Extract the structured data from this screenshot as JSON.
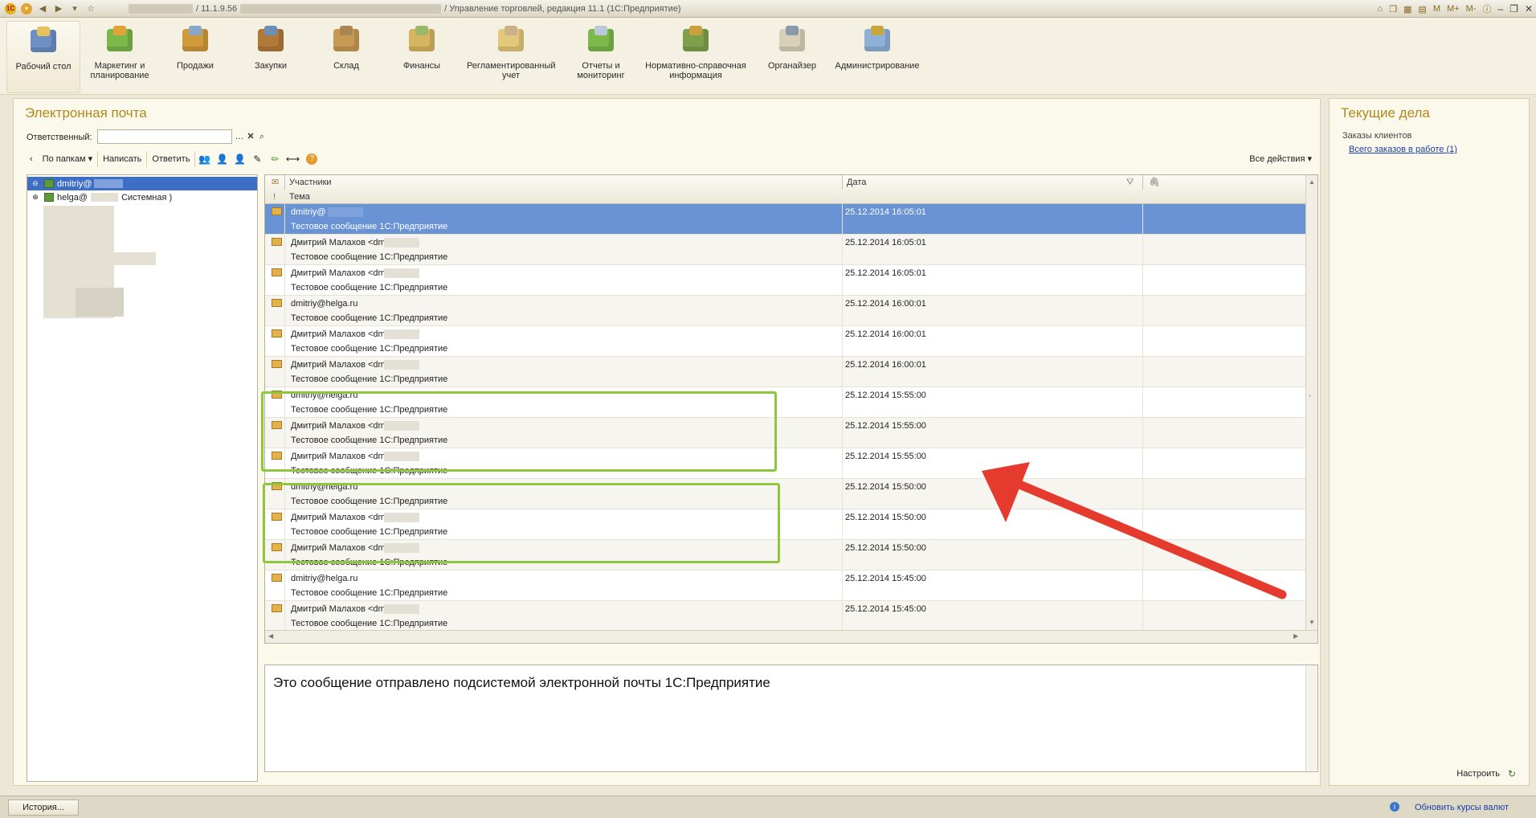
{
  "window": {
    "title_version": "/ 11.1.9.56",
    "title_app": "/ Управление торговлей, редакция 11.1  (1С:Предприятие)",
    "right_tools": [
      "M",
      "M+",
      "M-"
    ]
  },
  "sections": [
    {
      "label": "Рабочий стол",
      "active": true
    },
    {
      "label": "Маркетинг и планирование"
    },
    {
      "label": "Продажи"
    },
    {
      "label": "Закупки"
    },
    {
      "label": "Склад"
    },
    {
      "label": "Финансы"
    },
    {
      "label": "Регламентированный учет"
    },
    {
      "label": "Отчеты и мониторинг"
    },
    {
      "label": "Нормативно-справочная информация"
    },
    {
      "label": "Органайзер"
    },
    {
      "label": "Администрирование"
    }
  ],
  "mail": {
    "title": "Электронная почта",
    "responsible_label": "Ответственный:",
    "responsible_value": "",
    "toolbar": {
      "back": "‹",
      "by_folders": "По папкам ▾",
      "write": "Написать",
      "reply": "Ответить",
      "all_actions": "Все действия ▾"
    },
    "tree": [
      {
        "label": "dmitriy@",
        "selected": true,
        "expander": "⊖"
      },
      {
        "label": "helga@",
        "suffix": "Системная )",
        "expander": "⊕"
      }
    ],
    "columns": {
      "participants": "Участники",
      "date": "Дата",
      "subject": "Тема",
      "important": "!",
      "attachment": "🖇"
    },
    "messages": [
      {
        "from": "dmitriy@",
        "blurred": true,
        "date": "25.12.2014 16:05:01",
        "subject": "Тестовое сообщение 1С:Предприятие",
        "selected": true
      },
      {
        "from": "Дмитрий Малахов <dmitriy@",
        "blurred": true,
        "date": "25.12.2014 16:05:01",
        "subject": "Тестовое сообщение 1С:Предприятие"
      },
      {
        "from": "Дмитрий Малахов <dmitriy@",
        "blurred": true,
        "date": "25.12.2014 16:05:01",
        "subject": "Тестовое сообщение 1С:Предприятие"
      },
      {
        "from": "dmitriy@helga.ru",
        "date": "25.12.2014 16:00:01",
        "subject": "Тестовое сообщение 1С:Предприятие"
      },
      {
        "from": "Дмитрий Малахов <dmitriy@",
        "blurred": true,
        "date": "25.12.2014 16:00:01",
        "subject": "Тестовое сообщение 1С:Предприятие"
      },
      {
        "from": "Дмитрий Малахов <dmitriy@",
        "blurred": true,
        "date": "25.12.2014 16:00:01",
        "subject": "Тестовое сообщение 1С:Предприятие"
      },
      {
        "from": "dmitriy@helga.ru",
        "date": "25.12.2014 15:55:00",
        "subject": "Тестовое сообщение 1С:Предприятие"
      },
      {
        "from": "Дмитрий Малахов <dmitriy@",
        "blurred": true,
        "date": "25.12.2014 15:55:00",
        "subject": "Тестовое сообщение 1С:Предприятие"
      },
      {
        "from": "Дмитрий Малахов <dmitriy@",
        "blurred": true,
        "date": "25.12.2014 15:55:00",
        "subject": "Тестовое сообщение 1С:Предприятие"
      },
      {
        "from": "dmitriy@helga.ru",
        "date": "25.12.2014 15:50:00",
        "subject": "Тестовое сообщение 1С:Предприятие"
      },
      {
        "from": "Дмитрий Малахов <dmitriy@",
        "blurred": true,
        "date": "25.12.2014 15:50:00",
        "subject": "Тестовое сообщение 1С:Предприятие"
      },
      {
        "from": "Дмитрий Малахов <dmitriy@",
        "blurred": true,
        "date": "25.12.2014 15:50:00",
        "subject": "Тестовое сообщение 1С:Предприятие"
      },
      {
        "from": "dmitriy@helga.ru",
        "date": "25.12.2014 15:45:00",
        "subject": "Тестовое сообщение 1С:Предприятие"
      },
      {
        "from": "Дмитрий Малахов <dmitriy@",
        "blurred": true,
        "date": "25.12.2014 15:45:00",
        "subject": "Тестовое сообщение 1С:Предприятие"
      }
    ],
    "preview_text": "Это сообщение отправлено подсистемой электронной почты 1С:Предприятие"
  },
  "current_tasks": {
    "title": "Текущие дела",
    "group": "Заказы клиентов",
    "link": "Всего заказов в работе (1)",
    "configure": "Настроить"
  },
  "statusbar": {
    "history": "История...",
    "rates": "Обновить курсы валют"
  },
  "colors": {
    "accent_title": "#b08a1c",
    "selection": "#6a93d6",
    "highlight_box": "#8ec63f",
    "arrow": "#e53a2e"
  }
}
